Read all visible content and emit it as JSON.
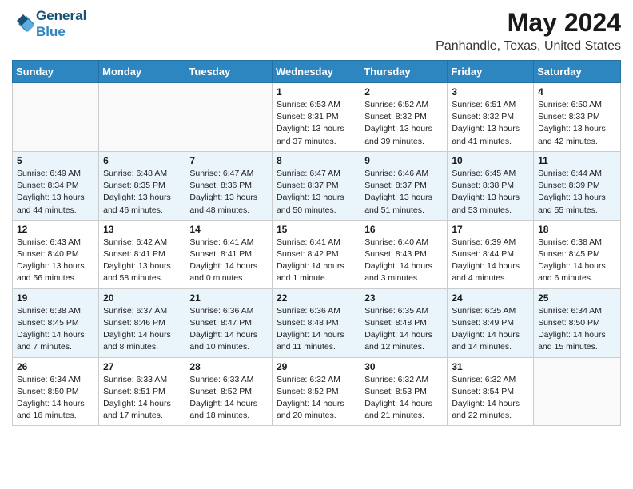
{
  "header": {
    "logo_line1": "General",
    "logo_line2": "Blue",
    "main_title": "May 2024",
    "subtitle": "Panhandle, Texas, United States"
  },
  "weekdays": [
    "Sunday",
    "Monday",
    "Tuesday",
    "Wednesday",
    "Thursday",
    "Friday",
    "Saturday"
  ],
  "weeks": [
    [
      {
        "day": "",
        "info": ""
      },
      {
        "day": "",
        "info": ""
      },
      {
        "day": "",
        "info": ""
      },
      {
        "day": "1",
        "info": "Sunrise: 6:53 AM\nSunset: 8:31 PM\nDaylight: 13 hours\nand 37 minutes."
      },
      {
        "day": "2",
        "info": "Sunrise: 6:52 AM\nSunset: 8:32 PM\nDaylight: 13 hours\nand 39 minutes."
      },
      {
        "day": "3",
        "info": "Sunrise: 6:51 AM\nSunset: 8:32 PM\nDaylight: 13 hours\nand 41 minutes."
      },
      {
        "day": "4",
        "info": "Sunrise: 6:50 AM\nSunset: 8:33 PM\nDaylight: 13 hours\nand 42 minutes."
      }
    ],
    [
      {
        "day": "5",
        "info": "Sunrise: 6:49 AM\nSunset: 8:34 PM\nDaylight: 13 hours\nand 44 minutes."
      },
      {
        "day": "6",
        "info": "Sunrise: 6:48 AM\nSunset: 8:35 PM\nDaylight: 13 hours\nand 46 minutes."
      },
      {
        "day": "7",
        "info": "Sunrise: 6:47 AM\nSunset: 8:36 PM\nDaylight: 13 hours\nand 48 minutes."
      },
      {
        "day": "8",
        "info": "Sunrise: 6:47 AM\nSunset: 8:37 PM\nDaylight: 13 hours\nand 50 minutes."
      },
      {
        "day": "9",
        "info": "Sunrise: 6:46 AM\nSunset: 8:37 PM\nDaylight: 13 hours\nand 51 minutes."
      },
      {
        "day": "10",
        "info": "Sunrise: 6:45 AM\nSunset: 8:38 PM\nDaylight: 13 hours\nand 53 minutes."
      },
      {
        "day": "11",
        "info": "Sunrise: 6:44 AM\nSunset: 8:39 PM\nDaylight: 13 hours\nand 55 minutes."
      }
    ],
    [
      {
        "day": "12",
        "info": "Sunrise: 6:43 AM\nSunset: 8:40 PM\nDaylight: 13 hours\nand 56 minutes."
      },
      {
        "day": "13",
        "info": "Sunrise: 6:42 AM\nSunset: 8:41 PM\nDaylight: 13 hours\nand 58 minutes."
      },
      {
        "day": "14",
        "info": "Sunrise: 6:41 AM\nSunset: 8:41 PM\nDaylight: 14 hours\nand 0 minutes."
      },
      {
        "day": "15",
        "info": "Sunrise: 6:41 AM\nSunset: 8:42 PM\nDaylight: 14 hours\nand 1 minute."
      },
      {
        "day": "16",
        "info": "Sunrise: 6:40 AM\nSunset: 8:43 PM\nDaylight: 14 hours\nand 3 minutes."
      },
      {
        "day": "17",
        "info": "Sunrise: 6:39 AM\nSunset: 8:44 PM\nDaylight: 14 hours\nand 4 minutes."
      },
      {
        "day": "18",
        "info": "Sunrise: 6:38 AM\nSunset: 8:45 PM\nDaylight: 14 hours\nand 6 minutes."
      }
    ],
    [
      {
        "day": "19",
        "info": "Sunrise: 6:38 AM\nSunset: 8:45 PM\nDaylight: 14 hours\nand 7 minutes."
      },
      {
        "day": "20",
        "info": "Sunrise: 6:37 AM\nSunset: 8:46 PM\nDaylight: 14 hours\nand 8 minutes."
      },
      {
        "day": "21",
        "info": "Sunrise: 6:36 AM\nSunset: 8:47 PM\nDaylight: 14 hours\nand 10 minutes."
      },
      {
        "day": "22",
        "info": "Sunrise: 6:36 AM\nSunset: 8:48 PM\nDaylight: 14 hours\nand 11 minutes."
      },
      {
        "day": "23",
        "info": "Sunrise: 6:35 AM\nSunset: 8:48 PM\nDaylight: 14 hours\nand 12 minutes."
      },
      {
        "day": "24",
        "info": "Sunrise: 6:35 AM\nSunset: 8:49 PM\nDaylight: 14 hours\nand 14 minutes."
      },
      {
        "day": "25",
        "info": "Sunrise: 6:34 AM\nSunset: 8:50 PM\nDaylight: 14 hours\nand 15 minutes."
      }
    ],
    [
      {
        "day": "26",
        "info": "Sunrise: 6:34 AM\nSunset: 8:50 PM\nDaylight: 14 hours\nand 16 minutes."
      },
      {
        "day": "27",
        "info": "Sunrise: 6:33 AM\nSunset: 8:51 PM\nDaylight: 14 hours\nand 17 minutes."
      },
      {
        "day": "28",
        "info": "Sunrise: 6:33 AM\nSunset: 8:52 PM\nDaylight: 14 hours\nand 18 minutes."
      },
      {
        "day": "29",
        "info": "Sunrise: 6:32 AM\nSunset: 8:52 PM\nDaylight: 14 hours\nand 20 minutes."
      },
      {
        "day": "30",
        "info": "Sunrise: 6:32 AM\nSunset: 8:53 PM\nDaylight: 14 hours\nand 21 minutes."
      },
      {
        "day": "31",
        "info": "Sunrise: 6:32 AM\nSunset: 8:54 PM\nDaylight: 14 hours\nand 22 minutes."
      },
      {
        "day": "",
        "info": ""
      }
    ]
  ]
}
